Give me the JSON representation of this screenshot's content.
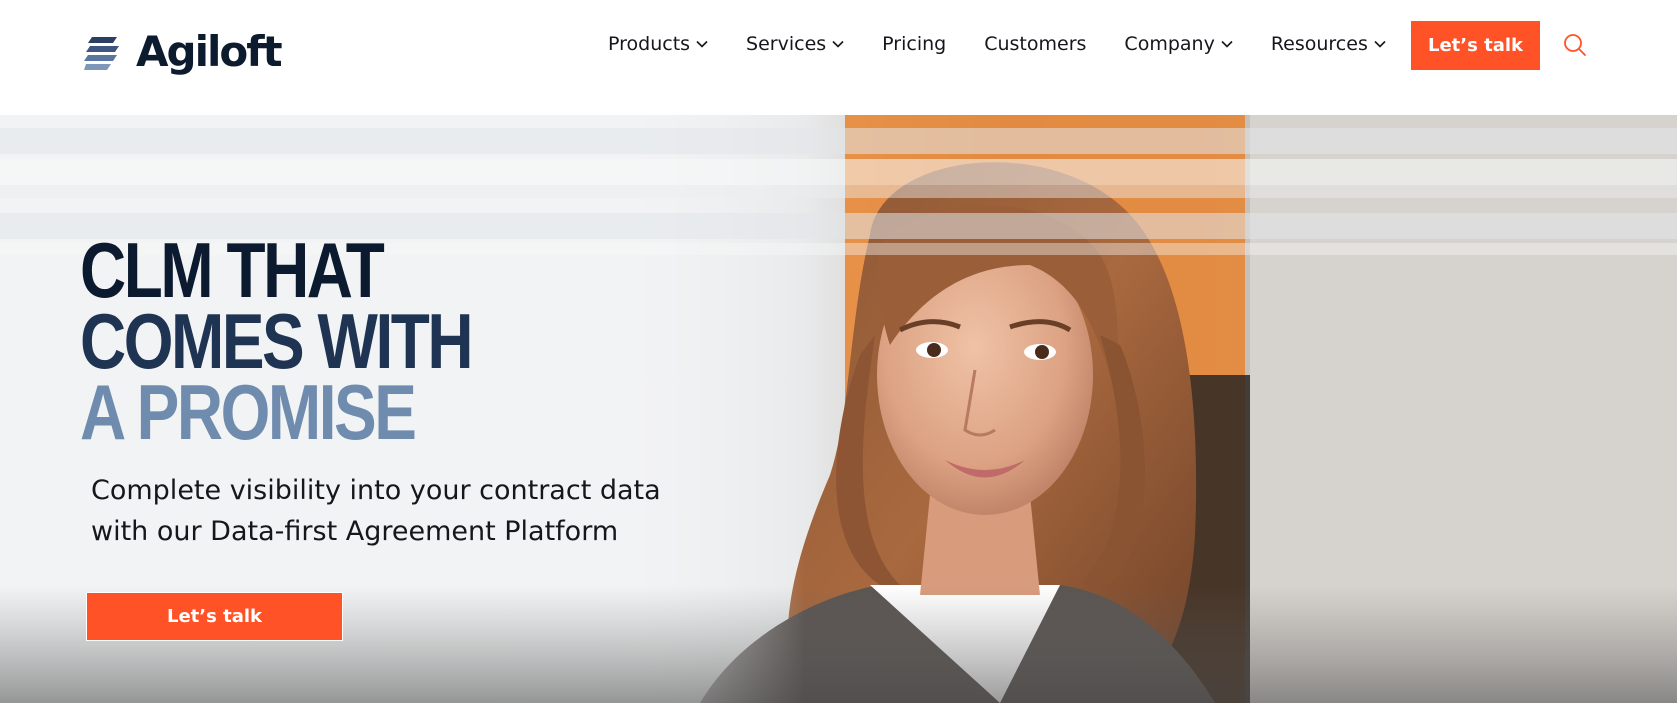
{
  "header": {
    "logo_text": "Agiloft",
    "nav": [
      {
        "label": "Products",
        "has_dropdown": true
      },
      {
        "label": "Services",
        "has_dropdown": true
      },
      {
        "label": "Pricing",
        "has_dropdown": false
      },
      {
        "label": "Customers",
        "has_dropdown": false
      },
      {
        "label": "Company",
        "has_dropdown": true
      },
      {
        "label": "Resources",
        "has_dropdown": true
      }
    ],
    "cta_label": "Let’s talk",
    "search_icon": "search-icon"
  },
  "hero": {
    "headline_lines": [
      "CLM THAT",
      "COMES WITH",
      "A PROMISE"
    ],
    "subheadline_line1": "Complete visibility into your contract data",
    "subheadline_line2": "with our Data-first Agreement Platform",
    "cta_label": "Let’s talk",
    "image_subject": "woman-portrait-photo"
  },
  "colors": {
    "accent": "#ff5227",
    "headline_dark": "#0c1a30",
    "headline_mid": "#1f3452",
    "headline_light": "#6f8cae",
    "text": "#15171c"
  }
}
